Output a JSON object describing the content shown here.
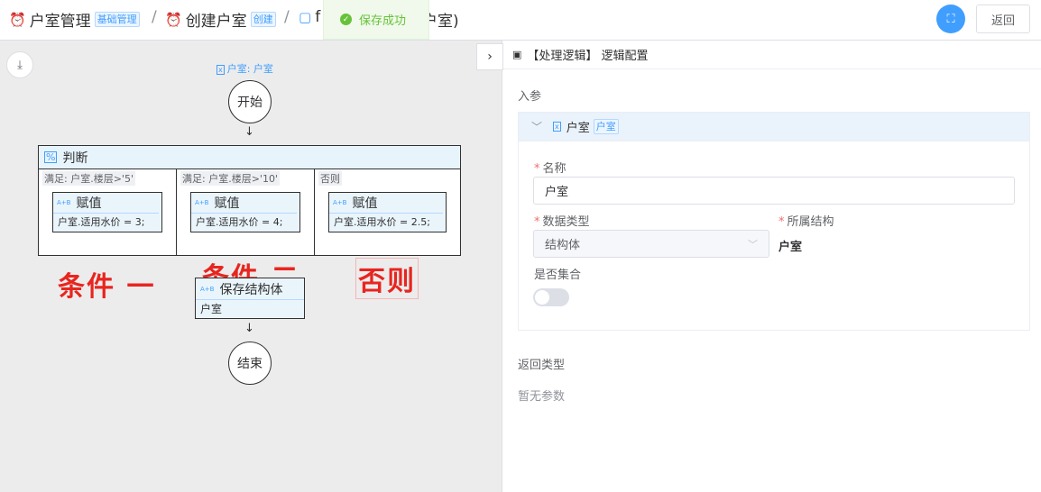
{
  "breadcrumb": {
    "item1": {
      "label": "户室管理",
      "tag": "基础管理"
    },
    "item2": {
      "label": "创建户室",
      "tag": "创建"
    },
    "item3": {
      "label_head": "f",
      "label_tail": "户室)"
    },
    "separator": "/"
  },
  "toast": {
    "message": "保存成功"
  },
  "header": {
    "back_label": "返回"
  },
  "flow": {
    "input_var": "户室: 户室",
    "start_label": "开始",
    "end_label": "结束",
    "judge_title": "判断",
    "branches": [
      {
        "condition": "满足: 户室.楼层>'5'",
        "node_title": "赋值",
        "node_value": "户室.适用水价 = 3;"
      },
      {
        "condition": "满足: 户室.楼层>'10'",
        "node_title": "赋值",
        "node_value": "户室.适用水价 = 4;"
      },
      {
        "condition": "否则",
        "node_title": "赋值",
        "node_value": "户室.适用水价 = 2.5;"
      }
    ],
    "save_node": {
      "title": "保存结构体",
      "value": "户室"
    },
    "ab_icon": "A+B"
  },
  "annotations": {
    "cond1": "条件 一",
    "cond2": "条件 二",
    "else": "否则"
  },
  "panel": {
    "title": "【处理逻辑】 逻辑配置",
    "input_params_label": "入参",
    "param_card": {
      "name": "户室",
      "tag": "户室"
    },
    "fields": {
      "name_label": "名称",
      "name_value": "户室",
      "type_label": "数据类型",
      "type_value": "结构体",
      "struct_label": "所属结构",
      "struct_value": "户室",
      "collection_label": "是否集合"
    },
    "return_type_label": "返回类型",
    "empty_text": "暂无参数"
  }
}
